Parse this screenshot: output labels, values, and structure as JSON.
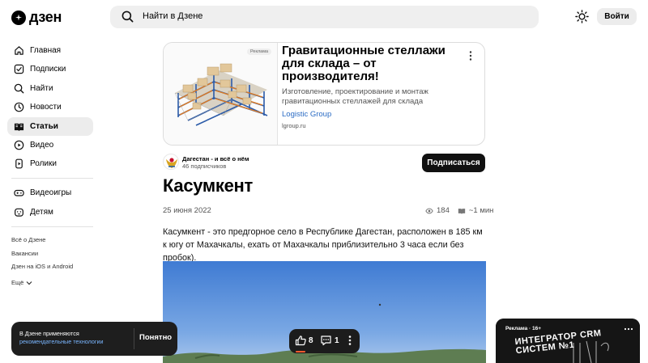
{
  "header": {
    "logo_text": "дзен",
    "search_placeholder": "Найти в Дзене",
    "login_label": "Войти"
  },
  "sidebar": {
    "items": [
      {
        "label": "Главная",
        "icon": "home-icon"
      },
      {
        "label": "Подписки",
        "icon": "subscriptions-icon"
      },
      {
        "label": "Найти",
        "icon": "search-icon"
      },
      {
        "label": "Новости",
        "icon": "news-icon"
      },
      {
        "label": "Статьи",
        "icon": "articles-icon",
        "active": true
      },
      {
        "label": "Видео",
        "icon": "video-icon"
      },
      {
        "label": "Ролики",
        "icon": "shorts-icon"
      }
    ],
    "items2": [
      {
        "label": "Видеоигры",
        "icon": "gamepad-icon"
      },
      {
        "label": "Детям",
        "icon": "kids-icon"
      }
    ],
    "links": [
      "Всё о Дзене",
      "Вакансии",
      "Дзен на iOS и Android",
      "Ещё"
    ]
  },
  "ad": {
    "badge": "Реклама",
    "title": "Гравитационные стеллажи для склада – от производителя!",
    "description": "Изготовление, проектирование и монтаж гравитационных стеллажей для склада",
    "brand": "Logistic Group",
    "domain": "lgroup.ru"
  },
  "channel": {
    "name": "Дагестан - и всё о нём",
    "subscribers": "46 подписчиков",
    "subscribe_label": "Подписаться"
  },
  "article": {
    "title": "Касумкент",
    "date": "25 июня 2022",
    "views": "184",
    "read_time": "~1 мин",
    "body": "Касумкент - это предгорное село в Республике Дагестан, расположен в 185 км к югу от Махачкалы, ехать от Махачкалы приблизительно 3 часа если без пробок)."
  },
  "cookie_banner": {
    "text": "В Дзене применяются",
    "link": "рекомендательные технологии",
    "button": "Понятно"
  },
  "actions": {
    "likes": "8",
    "comments": "1"
  },
  "video_ad": {
    "label": "Реклама · 16+",
    "overlay_text": "ИНТЕГРАТОР CRM СИСТЕМ №1"
  },
  "colors": {
    "accent_link": "#2b6cc4",
    "like_indicator": "#ff5a2e"
  }
}
